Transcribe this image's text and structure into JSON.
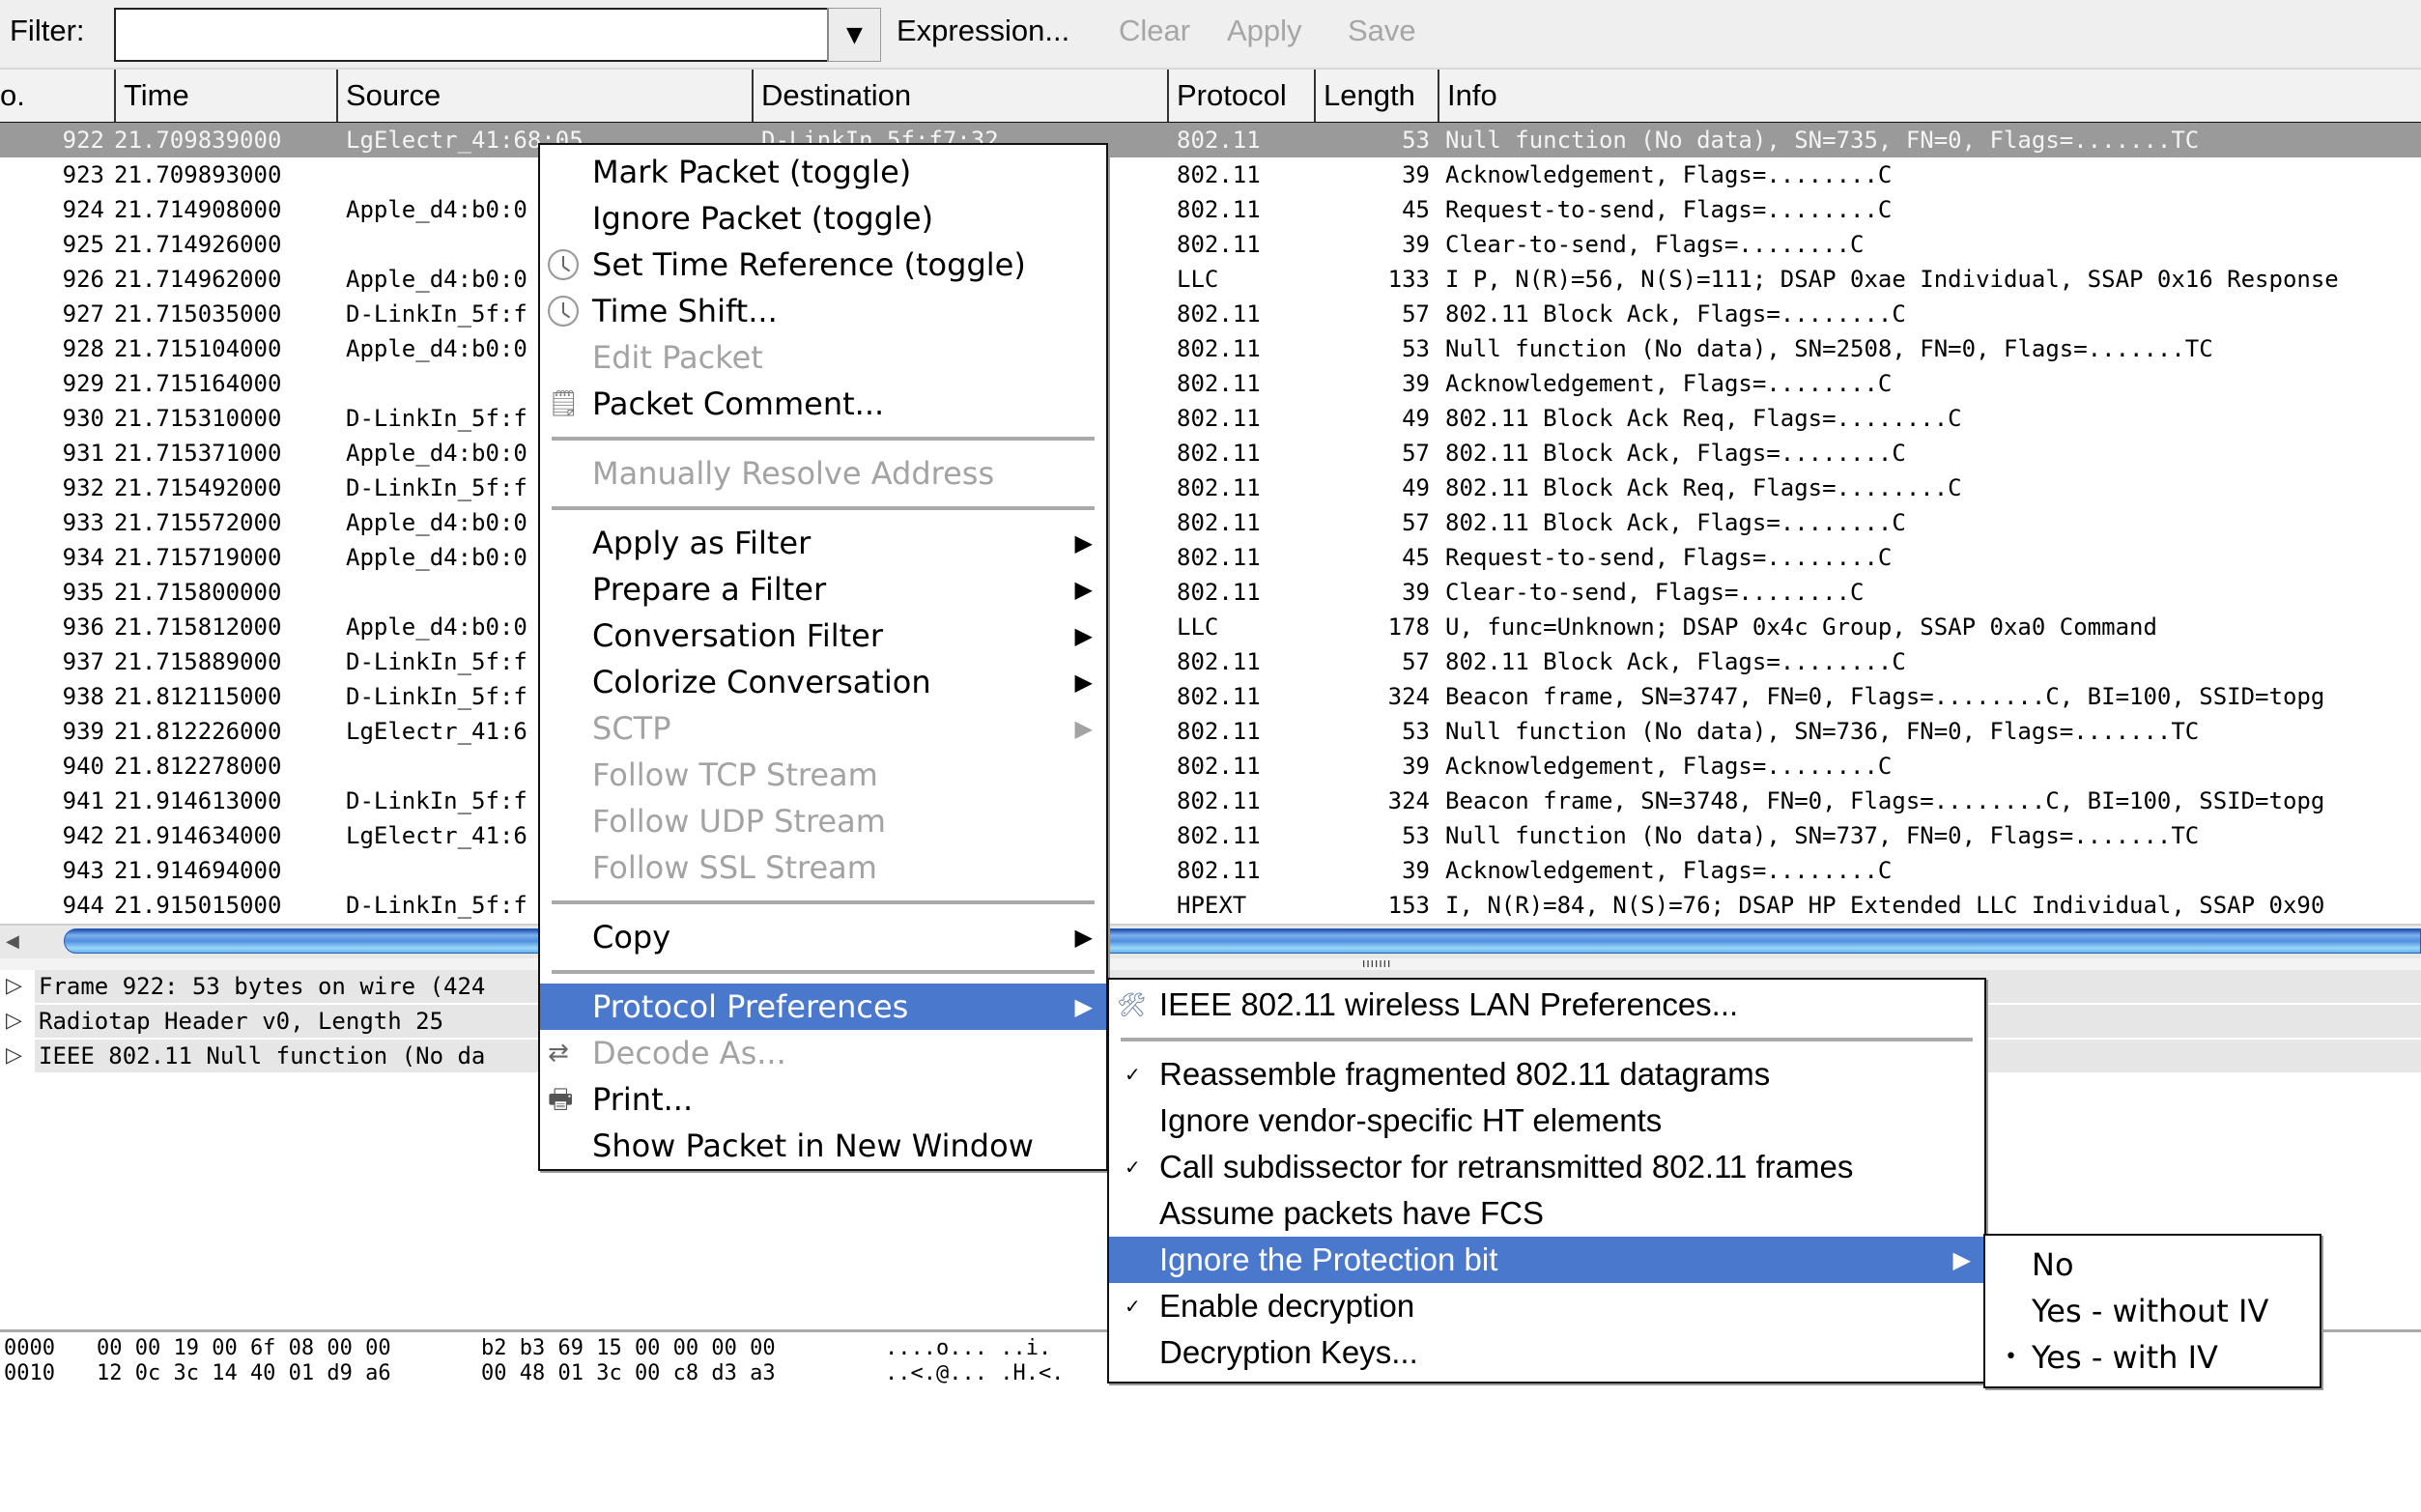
{
  "toolbar": {
    "filter_label": "Filter:",
    "filter_value": "",
    "dropdown_icon": "▼",
    "expression_label": "Expression...",
    "clear_label": "Clear",
    "apply_label": "Apply",
    "save_label": "Save"
  },
  "columns": [
    "o.",
    "Time",
    "Source",
    "Destination",
    "Protocol",
    "Length",
    "Info"
  ],
  "packets": [
    {
      "no": "922",
      "time": "21.709839000",
      "src": "LgElectr_41:68:05",
      "dst": "D-LinkIn_5f:f7:32",
      "proto": "802.11",
      "len": "53",
      "info": "Null function (No data), SN=735, FN=0, Flags=.......TC",
      "selected": true
    },
    {
      "no": "923",
      "time": "21.709893000",
      "src": "",
      "dst": "",
      "proto": "802.11",
      "len": "39",
      "info": "Acknowledgement, Flags=........C"
    },
    {
      "no": "924",
      "time": "21.714908000",
      "src": "Apple_d4:b0:0",
      "dst": "",
      "proto": "802.11",
      "len": "45",
      "info": "Request-to-send, Flags=........C"
    },
    {
      "no": "925",
      "time": "21.714926000",
      "src": "",
      "dst": "",
      "proto": "802.11",
      "len": "39",
      "info": "Clear-to-send, Flags=........C"
    },
    {
      "no": "926",
      "time": "21.714962000",
      "src": "Apple_d4:b0:0",
      "dst": "",
      "proto": "LLC",
      "len": "133",
      "info": "I P, N(R)=56, N(S)=111; DSAP 0xae Individual, SSAP 0x16 Response"
    },
    {
      "no": "927",
      "time": "21.715035000",
      "src": "D-LinkIn_5f:f",
      "dst": "",
      "proto": "802.11",
      "len": "57",
      "info": "802.11 Block Ack, Flags=........C"
    },
    {
      "no": "928",
      "time": "21.715104000",
      "src": "Apple_d4:b0:0",
      "dst": "",
      "proto": "802.11",
      "len": "53",
      "info": "Null function (No data), SN=2508, FN=0, Flags=.......TC"
    },
    {
      "no": "929",
      "time": "21.715164000",
      "src": "",
      "dst": "",
      "proto": "802.11",
      "len": "39",
      "info": "Acknowledgement, Flags=........C"
    },
    {
      "no": "930",
      "time": "21.715310000",
      "src": "D-LinkIn_5f:f",
      "dst": "",
      "proto": "802.11",
      "len": "49",
      "info": "802.11 Block Ack Req, Flags=........C"
    },
    {
      "no": "931",
      "time": "21.715371000",
      "src": "Apple_d4:b0:0",
      "dst": "",
      "proto": "802.11",
      "len": "57",
      "info": "802.11 Block Ack, Flags=........C"
    },
    {
      "no": "932",
      "time": "21.715492000",
      "src": "D-LinkIn_5f:f",
      "dst": "",
      "proto": "802.11",
      "len": "49",
      "info": "802.11 Block Ack Req, Flags=........C"
    },
    {
      "no": "933",
      "time": "21.715572000",
      "src": "Apple_d4:b0:0",
      "dst": "",
      "proto": "802.11",
      "len": "57",
      "info": "802.11 Block Ack, Flags=........C"
    },
    {
      "no": "934",
      "time": "21.715719000",
      "src": "Apple_d4:b0:0",
      "dst": "",
      "proto": "802.11",
      "len": "45",
      "info": "Request-to-send, Flags=........C"
    },
    {
      "no": "935",
      "time": "21.715800000",
      "src": "",
      "dst": "",
      "proto": "802.11",
      "len": "39",
      "info": "Clear-to-send, Flags=........C"
    },
    {
      "no": "936",
      "time": "21.715812000",
      "src": "Apple_d4:b0:0",
      "dst": "",
      "proto": "LLC",
      "len": "178",
      "info": "U, func=Unknown; DSAP 0x4c Group, SSAP 0xa0 Command"
    },
    {
      "no": "937",
      "time": "21.715889000",
      "src": "D-LinkIn_5f:f",
      "dst": "",
      "proto": "802.11",
      "len": "57",
      "info": "802.11 Block Ack, Flags=........C"
    },
    {
      "no": "938",
      "time": "21.812115000",
      "src": "D-LinkIn_5f:f",
      "dst": "",
      "proto": "802.11",
      "len": "324",
      "info": "Beacon frame, SN=3747, FN=0, Flags=........C, BI=100, SSID=topg"
    },
    {
      "no": "939",
      "time": "21.812226000",
      "src": "LgElectr_41:6",
      "dst": "",
      "proto": "802.11",
      "len": "53",
      "info": "Null function (No data), SN=736, FN=0, Flags=.......TC"
    },
    {
      "no": "940",
      "time": "21.812278000",
      "src": "",
      "dst": "",
      "proto": "802.11",
      "len": "39",
      "info": "Acknowledgement, Flags=........C"
    },
    {
      "no": "941",
      "time": "21.914613000",
      "src": "D-LinkIn_5f:f",
      "dst": "",
      "proto": "802.11",
      "len": "324",
      "info": "Beacon frame, SN=3748, FN=0, Flags=........C, BI=100, SSID=topg"
    },
    {
      "no": "942",
      "time": "21.914634000",
      "src": "LgElectr_41:6",
      "dst": "",
      "proto": "802.11",
      "len": "53",
      "info": "Null function (No data), SN=737, FN=0, Flags=.......TC"
    },
    {
      "no": "943",
      "time": "21.914694000",
      "src": "",
      "dst": "",
      "proto": "802.11",
      "len": "39",
      "info": "Acknowledgement, Flags=........C"
    },
    {
      "no": "944",
      "time": "21.915015000",
      "src": "D-LinkIn_5f:f",
      "dst": "",
      "proto": "HPEXT",
      "len": "153",
      "info": "I, N(R)=84, N(S)=76; DSAP HP Extended LLC Individual, SSAP 0x90"
    }
  ],
  "details": [
    {
      "text": "Frame 922: 53 bytes on wire (424"
    },
    {
      "text": "Radiotap Header v0, Length 25"
    },
    {
      "text": "IEEE 802.11 Null function (No da"
    }
  ],
  "bytes": [
    {
      "offset": "0000",
      "hex1": "00 00 19 00 6f 08 00 00",
      "hex2": "b2 b3 69 15 00 00 00 00",
      "ascii": "....o... ..i."
    },
    {
      "offset": "0010",
      "hex1": "12 0c 3c 14 40 01 d9 a6",
      "hex2": "00 48 01 3c 00 c8 d3 a3",
      "ascii": "..<.@... .H.<."
    }
  ],
  "context_menu": {
    "items": [
      {
        "label": "Mark Packet (toggle)",
        "icon": "",
        "disabled": false,
        "submenu": false
      },
      {
        "label": "Ignore Packet (toggle)",
        "icon": "",
        "disabled": false,
        "submenu": false
      },
      {
        "label": "Set Time Reference (toggle)",
        "icon": "clock-icon",
        "disabled": false,
        "submenu": false
      },
      {
        "label": "Time Shift...",
        "icon": "clock-icon",
        "disabled": false,
        "submenu": false
      },
      {
        "label": "Edit Packet",
        "icon": "",
        "disabled": true,
        "submenu": false
      },
      {
        "label": "Packet Comment...",
        "icon": "comment-icon",
        "disabled": false,
        "submenu": false
      },
      {
        "separator": true
      },
      {
        "label": "Manually Resolve Address",
        "icon": "",
        "disabled": true,
        "submenu": false
      },
      {
        "separator": true
      },
      {
        "label": "Apply as Filter",
        "icon": "",
        "disabled": false,
        "submenu": true
      },
      {
        "label": "Prepare a Filter",
        "icon": "",
        "disabled": false,
        "submenu": true
      },
      {
        "label": "Conversation Filter",
        "icon": "",
        "disabled": false,
        "submenu": true
      },
      {
        "label": "Colorize Conversation",
        "icon": "",
        "disabled": false,
        "submenu": true
      },
      {
        "label": "SCTP",
        "icon": "",
        "disabled": true,
        "submenu": true
      },
      {
        "label": "Follow TCP Stream",
        "icon": "",
        "disabled": true,
        "submenu": false
      },
      {
        "label": "Follow UDP Stream",
        "icon": "",
        "disabled": true,
        "submenu": false
      },
      {
        "label": "Follow SSL Stream",
        "icon": "",
        "disabled": true,
        "submenu": false
      },
      {
        "separator": true
      },
      {
        "label": "Copy",
        "icon": "",
        "disabled": false,
        "submenu": true
      },
      {
        "separator": true
      },
      {
        "label": "Protocol Preferences",
        "icon": "",
        "disabled": false,
        "submenu": true,
        "highlighted": true
      },
      {
        "label": "Decode As...",
        "icon": "decode-icon",
        "disabled": true,
        "submenu": false
      },
      {
        "label": "Print...",
        "icon": "printer-icon",
        "disabled": false,
        "submenu": false
      },
      {
        "label": "Show Packet in New Window",
        "icon": "",
        "disabled": false,
        "submenu": false
      }
    ]
  },
  "protocol_prefs_menu": {
    "items": [
      {
        "label": "IEEE 802.11 wireless LAN Preferences...",
        "icon": "tools-icon"
      },
      {
        "separator": true
      },
      {
        "label": "Reassemble fragmented 802.11 datagrams",
        "checked": true
      },
      {
        "label": "Ignore vendor-specific HT elements",
        "checked": false
      },
      {
        "label": "Call subdissector for retransmitted 802.11 frames",
        "checked": true
      },
      {
        "label": "Assume packets have FCS",
        "checked": false
      },
      {
        "label": "Ignore the Protection bit",
        "submenu": true,
        "highlighted": true
      },
      {
        "label": "Enable decryption",
        "checked": true
      },
      {
        "label": "Decryption Keys...",
        "checked": false
      }
    ]
  },
  "protection_bit_menu": {
    "items": [
      {
        "label": "No",
        "selected": false
      },
      {
        "label": "Yes - without IV",
        "selected": false
      },
      {
        "label": "Yes - with IV",
        "selected": true
      }
    ]
  },
  "colors": {
    "highlight": "#4a78cc",
    "selected_row": "#9a9a9a",
    "disabled_text": "#a3a3a3"
  }
}
